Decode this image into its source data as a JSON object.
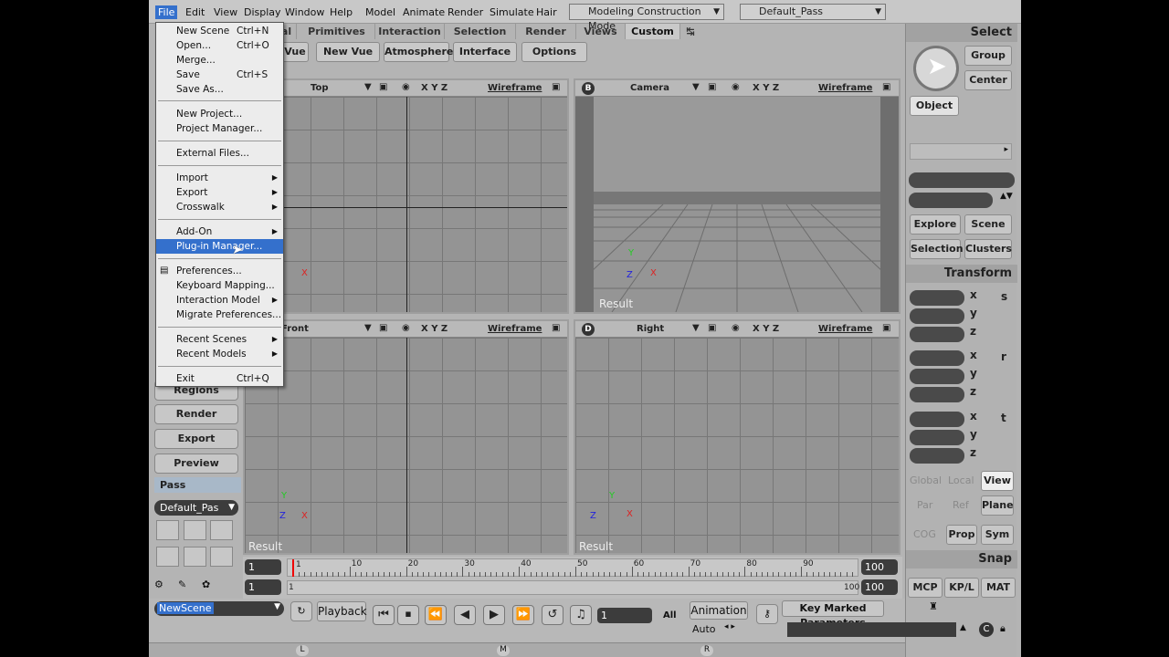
{
  "menubar": {
    "items": [
      "File",
      "Edit",
      "View",
      "Display",
      "Window",
      "Help",
      "Model",
      "Animate",
      "Render",
      "Simulate",
      "Hair"
    ],
    "mode": "Modeling Construction Mode",
    "pass": "Default_Pass"
  },
  "tabs": [
    "al",
    "Primitives",
    "Interaction",
    "Selection",
    "Render",
    "Views",
    "Custom"
  ],
  "toolbar": [
    "Vue",
    "New Vue",
    "Atmosphere",
    "Interface",
    "Options"
  ],
  "file_menu": {
    "items": [
      {
        "label": "New Scene",
        "shortcut": "Ctrl+N"
      },
      {
        "label": "Open...",
        "shortcut": "Ctrl+O"
      },
      {
        "label": "Merge...",
        "shortcut": ""
      },
      {
        "label": "Save",
        "shortcut": "Ctrl+S"
      },
      {
        "label": "Save As...",
        "shortcut": ""
      },
      {
        "label": "New Project...",
        "shortcut": ""
      },
      {
        "label": "Project Manager...",
        "shortcut": ""
      },
      {
        "label": "External Files...",
        "shortcut": ""
      },
      {
        "label": "Import",
        "shortcut": ""
      },
      {
        "label": "Export",
        "shortcut": ""
      },
      {
        "label": "Crosswalk",
        "shortcut": ""
      },
      {
        "label": "Add-On",
        "shortcut": ""
      },
      {
        "label": "Plug-in Manager...",
        "shortcut": ""
      },
      {
        "label": "Preferences...",
        "shortcut": ""
      },
      {
        "label": "Keyboard Mapping...",
        "shortcut": ""
      },
      {
        "label": "Interaction Model",
        "shortcut": ""
      },
      {
        "label": "Migrate Preferences...",
        "shortcut": ""
      },
      {
        "label": "Recent Scenes",
        "shortcut": ""
      },
      {
        "label": "Recent Models",
        "shortcut": ""
      },
      {
        "label": "Exit",
        "shortcut": "Ctrl+Q"
      }
    ]
  },
  "viewports": {
    "a": {
      "name": "Top",
      "xyz": "X Y Z",
      "mode": "Wireframe"
    },
    "b": {
      "letter": "B",
      "name": "Camera",
      "xyz": "X Y Z",
      "mode": "Wireframe",
      "result": "Result"
    },
    "c": {
      "name": "Front",
      "xyz": "X Y Z",
      "mode": "Wireframe",
      "result": "Result"
    },
    "d": {
      "letter": "D",
      "name": "Right",
      "xyz": "X Y Z",
      "mode": "Wireframe",
      "result": "Result"
    }
  },
  "axis_labels": {
    "x": "X",
    "y": "Y",
    "z": "Z"
  },
  "left_panel": {
    "buttons": [
      "Regions",
      "Render",
      "Export",
      "Preview"
    ],
    "pass_label": "Pass",
    "pass_value": "Default_Pas"
  },
  "right_panel": {
    "select": "Select",
    "group": "Group",
    "center": "Center",
    "object": "Object",
    "explore": "Explore",
    "scene": "Scene",
    "selection": "Selection",
    "clusters": "Clusters",
    "transform": "Transform",
    "axes": [
      "x",
      "y",
      "z"
    ],
    "scale": "s",
    "rotate": "r",
    "translate": "t",
    "global": "Global",
    "local": "Local",
    "view": "View",
    "par": "Par",
    "ref": "Ref",
    "plane": "Plane",
    "cog": "COG",
    "prop": "Prop",
    "sym": "Sym",
    "snap": "Snap",
    "mcp": "MCP",
    "kpl": "KP/L",
    "mat": "MAT"
  },
  "timeline": {
    "start": "1",
    "end": "100",
    "ticks": [
      "1",
      "10",
      "20",
      "30",
      "40",
      "50",
      "60",
      "70",
      "80",
      "90"
    ],
    "current": "1",
    "range_start": "1",
    "range_end": "100",
    "range_end2": "100"
  },
  "bottom": {
    "scene_name": "NewScene",
    "playback": "Playback",
    "frame": "1",
    "all": "All",
    "animation": "Animation",
    "auto": "Auto",
    "key_marked": "Key Marked Parameters",
    "lmr": [
      "L",
      "M",
      "R"
    ]
  }
}
